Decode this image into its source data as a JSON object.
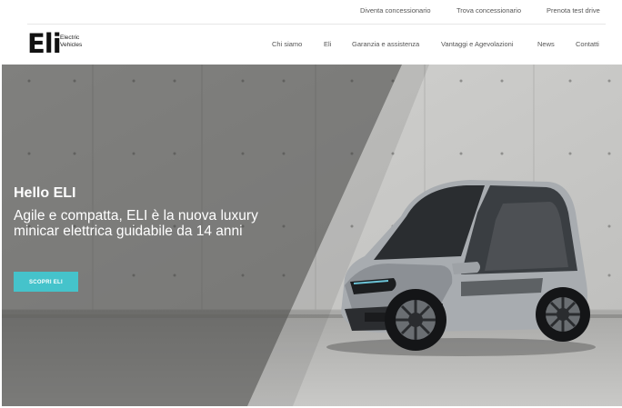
{
  "topbar": {
    "links": [
      "Diventa concessionario",
      "Trova concessionario",
      "Prenota test drive"
    ]
  },
  "logo": {
    "mark": "Eli",
    "line1": "Electric",
    "line2": "Vehicles"
  },
  "menu": {
    "items": [
      "Chi siamo",
      "Eli",
      "Garanzia e assistenza",
      "Vantaggi e Agevolazioni",
      "News",
      "Contatti"
    ]
  },
  "hero": {
    "title": "Hello ELI",
    "subtitle": "Agile e compatta, ELI è la nuova luxury minicar elettrica guidabile da 14 anni",
    "cta_label": "SCOPRI ELI",
    "accent_color": "#45c3cb"
  },
  "icons": {
    "car_image": "electric-minicar-icon"
  }
}
